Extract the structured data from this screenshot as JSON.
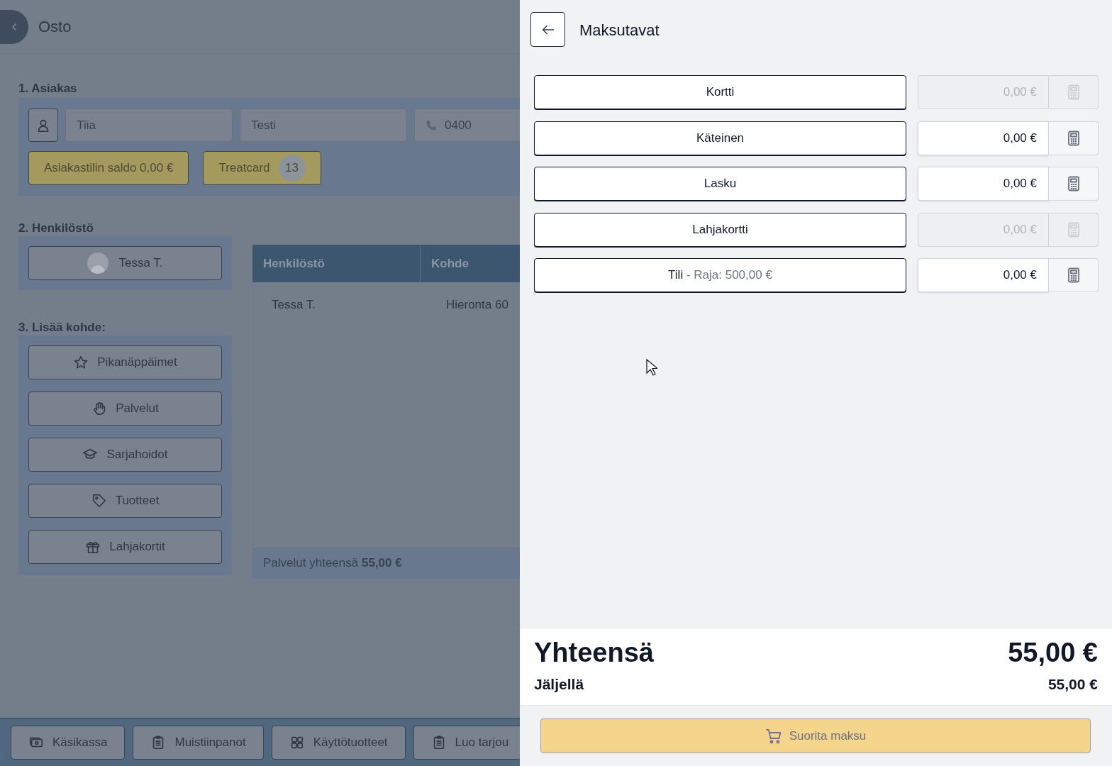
{
  "page": {
    "title": "Osto"
  },
  "customer": {
    "heading": "1. Asiakas",
    "first_name": "Tiia",
    "last_name": "Testi",
    "phone": "0400",
    "badges": [
      {
        "label": "Asiakastilin saldo 0,00 €"
      },
      {
        "label": "Treatcard",
        "count": "13"
      }
    ]
  },
  "staff": {
    "heading": "2. Henkilöstö",
    "member": "Tessa T."
  },
  "table": {
    "columns": [
      "Henkilöstö",
      "Kohde"
    ],
    "rows": [
      [
        "Tessa T.",
        "Hieronta 60"
      ]
    ],
    "footer": "Palvelut yhteensä **55,00 €**"
  },
  "add_item": {
    "heading": "3. Lisää kohde:",
    "buttons": [
      "Pikanäppäimet",
      "Palvelut",
      "Sarjahoidot",
      "Tuotteet",
      "Lahjakortit"
    ]
  },
  "bottom_bar": [
    "Käsikassa",
    "Muistiinpanot",
    "Käyttötuotteet",
    "Luo tarjou"
  ],
  "drawer": {
    "title": "Maksutavat",
    "methods": [
      {
        "label": "Kortti",
        "amount": "0,00 €",
        "disabled": true
      },
      {
        "label": "Käteinen",
        "amount": "0,00 €",
        "disabled": false
      },
      {
        "label": "Lasku",
        "amount": "0,00 €",
        "disabled": false
      },
      {
        "label": "Lahjakortti",
        "amount": "0,00 €",
        "disabled": true
      },
      {
        "label": "Tili",
        "note": " - Raja: 500,00 €",
        "amount": "0,00 €",
        "disabled": false
      }
    ],
    "total_label": "Yhteensä",
    "total": "55,00 €",
    "remaining_label": "Jäljellä",
    "remaining": "55,00 €",
    "pay_button": "Suorita maksu"
  }
}
